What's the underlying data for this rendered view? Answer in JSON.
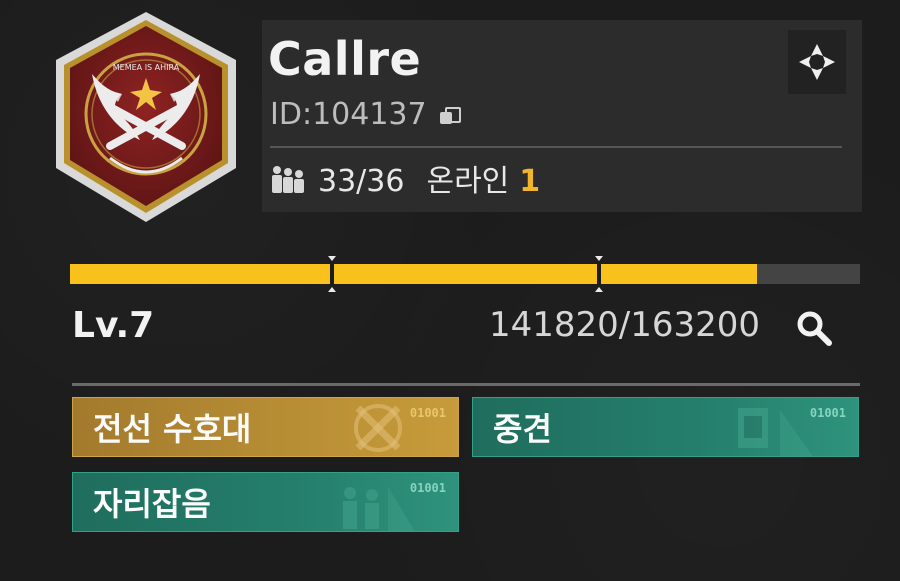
{
  "guild": {
    "emblem_motto": "MEMEA IS AHIRA",
    "name": "Callre",
    "id_label": "ID:",
    "id_value": "104137",
    "members_count": "33/36",
    "online_label": "온라인",
    "online_count": "1"
  },
  "progress": {
    "level": "Lv.7",
    "xp_text": "141820/163200",
    "xp_current": 141820,
    "xp_max": 163200
  },
  "tags": [
    {
      "label": "전선 수호대",
      "code": "01001",
      "style": "gold"
    },
    {
      "label": "중견",
      "code": "01001",
      "style": "teal"
    },
    {
      "label": "자리잡음",
      "code": "01001",
      "style": "teal"
    }
  ],
  "colors": {
    "accent_yellow": "#f8c11c",
    "online_orange": "#f0b52a",
    "panel_bg": "#2c2c2c",
    "tag_gold": "#b98f35",
    "tag_teal": "#257f6d",
    "emblem_red": "#7e1c1c"
  },
  "icons": {
    "emblem": "guild-emblem-icon",
    "copy": "copy-icon",
    "members": "members-icon",
    "target": "target-icon",
    "search": "search-icon"
  }
}
